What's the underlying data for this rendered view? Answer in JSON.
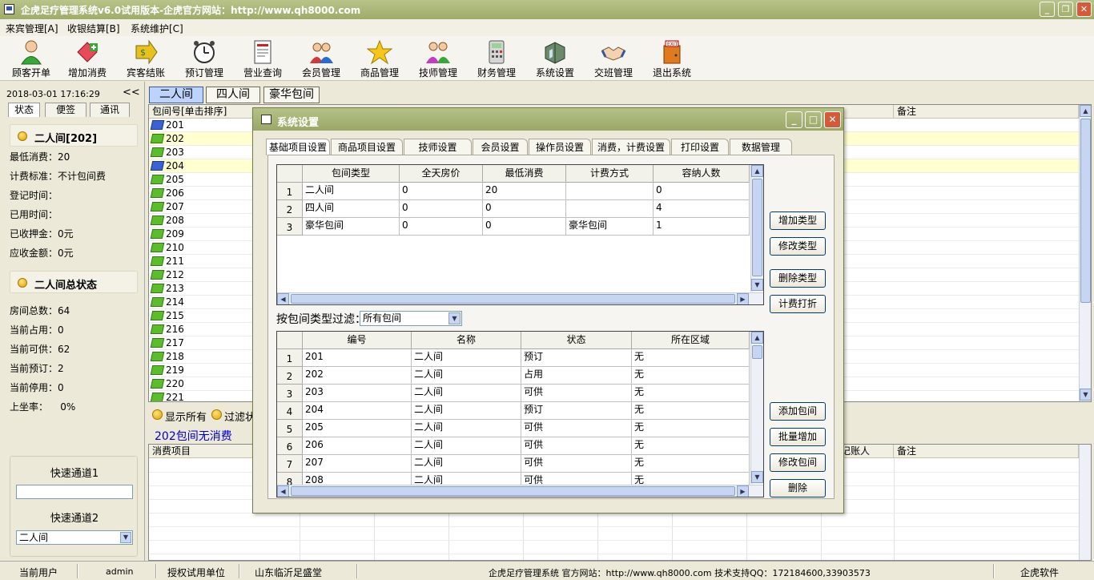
{
  "window": {
    "title": "企虎足疗管理系统v6.0试用版本-企虎官方网站：http://www.qh8000.com"
  },
  "menu": [
    "来宾管理[A]",
    "收银结算[B]",
    "系统维护[C]"
  ],
  "toolbar": [
    {
      "label": "顾客开单",
      "icon": "customer-person-icon"
    },
    {
      "label": "增加消费",
      "icon": "add-consumption-icon"
    },
    {
      "label": "宾客结账",
      "icon": "checkout-arrow-icon"
    },
    {
      "label": "预订管理",
      "icon": "alarm-clock-icon"
    },
    {
      "label": "营业查询",
      "icon": "report-query-icon"
    },
    {
      "label": "会员管理",
      "icon": "members-icon"
    },
    {
      "label": "商品管理",
      "icon": "star-icon"
    },
    {
      "label": "技师管理",
      "icon": "technicians-icon"
    },
    {
      "label": "财务管理",
      "icon": "calculator-icon"
    },
    {
      "label": "系统设置",
      "icon": "settings-box-icon"
    },
    {
      "label": "交班管理",
      "icon": "handshake-icon"
    },
    {
      "label": "退出系统",
      "icon": "exit-door-icon"
    }
  ],
  "left": {
    "datetime": "2018-03-01 17:16:29",
    "collapse": "<<",
    "tabs": [
      "状态",
      "便签",
      "通讯"
    ],
    "room_title": "二人间[202]",
    "room_info": [
      "最低消费：20",
      "计费标准：不计包间费",
      "登记时间：",
      "已用时间：",
      "已收押金：0元",
      "应收金额：0元"
    ],
    "summary_title": "二人间总状态",
    "summary_info": [
      "房间总数：64",
      "当前占用：0",
      "当前可供：62",
      "当前预订：2",
      "当前停用：0",
      "上坐率：    0%"
    ],
    "quick1_label": "快速通道1",
    "quick1_value": "",
    "quick2_label": "快速通道2",
    "quick2_value": "二人间"
  },
  "main": {
    "room_tabs": [
      "二人间",
      "四人间",
      "豪华包间"
    ],
    "grid_headers": [
      "包间号[单击排序]",
      "备注"
    ],
    "rooms": [
      {
        "no": "201",
        "status": "reserved"
      },
      {
        "no": "202",
        "status": "available"
      },
      {
        "no": "203",
        "status": "available"
      },
      {
        "no": "204",
        "status": "reserved"
      },
      {
        "no": "205",
        "status": "available"
      },
      {
        "no": "206",
        "status": "available"
      },
      {
        "no": "207",
        "status": "available"
      },
      {
        "no": "208",
        "status": "available"
      },
      {
        "no": "209",
        "status": "available"
      },
      {
        "no": "210",
        "status": "available"
      },
      {
        "no": "211",
        "status": "available"
      },
      {
        "no": "212",
        "status": "available"
      },
      {
        "no": "213",
        "status": "available"
      },
      {
        "no": "214",
        "status": "available"
      },
      {
        "no": "215",
        "status": "available"
      },
      {
        "no": "216",
        "status": "available"
      },
      {
        "no": "217",
        "status": "available"
      },
      {
        "no": "218",
        "status": "available"
      },
      {
        "no": "219",
        "status": "available"
      },
      {
        "no": "220",
        "status": "available"
      },
      {
        "no": "221",
        "status": "available"
      }
    ],
    "show_all": "显示所有",
    "filter": "过滤状",
    "no_consume": "202包间无消费",
    "consume_headers": [
      "消费项目",
      "记账人",
      "备注"
    ]
  },
  "statusbar": {
    "user_label": "当前用户",
    "user": "admin",
    "auth_label": "授权试用单位",
    "auth_value": "山东临沂足盛堂",
    "info": "企虎足疗管理系统 官方网站：http://www.qh8000.com 技术支持QQ：172184600,33903573",
    "brand": "企虎软件"
  },
  "dialog": {
    "title": "系统设置",
    "tabs": [
      "基础项目设置",
      "商品项目设置",
      "技师设置",
      "会员设置",
      "操作员设置",
      "消费，计费设置",
      "打印设置",
      "数据管理"
    ],
    "type_grid": {
      "headers": [
        "包间类型",
        "全天房价",
        "最低消费",
        "计费方式",
        "容纳人数"
      ],
      "rows": [
        [
          "1",
          "二人间",
          "0",
          "20",
          "",
          "0"
        ],
        [
          "2",
          "四人间",
          "0",
          "0",
          "",
          "4"
        ],
        [
          "3",
          "豪华包间",
          "0",
          "0",
          "豪华包间",
          "1"
        ]
      ]
    },
    "type_buttons": [
      "增加类型",
      "修改类型",
      "删除类型",
      "计费打折"
    ],
    "filter_label": "按包间类型过滤：",
    "filter_value": "所有包间",
    "room_grid": {
      "headers": [
        "编号",
        "名称",
        "状态",
        "所在区域"
      ],
      "rows": [
        [
          "1",
          "201",
          "二人间",
          "预订",
          "无"
        ],
        [
          "2",
          "202",
          "二人间",
          "占用",
          "无"
        ],
        [
          "3",
          "203",
          "二人间",
          "可供",
          "无"
        ],
        [
          "4",
          "204",
          "二人间",
          "预订",
          "无"
        ],
        [
          "5",
          "205",
          "二人间",
          "可供",
          "无"
        ],
        [
          "6",
          "206",
          "二人间",
          "可供",
          "无"
        ],
        [
          "7",
          "207",
          "二人间",
          "可供",
          "无"
        ],
        [
          "8",
          "208",
          "二人间",
          "可供",
          "无"
        ]
      ]
    },
    "room_buttons": [
      "添加包间",
      "批量增加",
      "修改包间",
      "删除"
    ]
  }
}
